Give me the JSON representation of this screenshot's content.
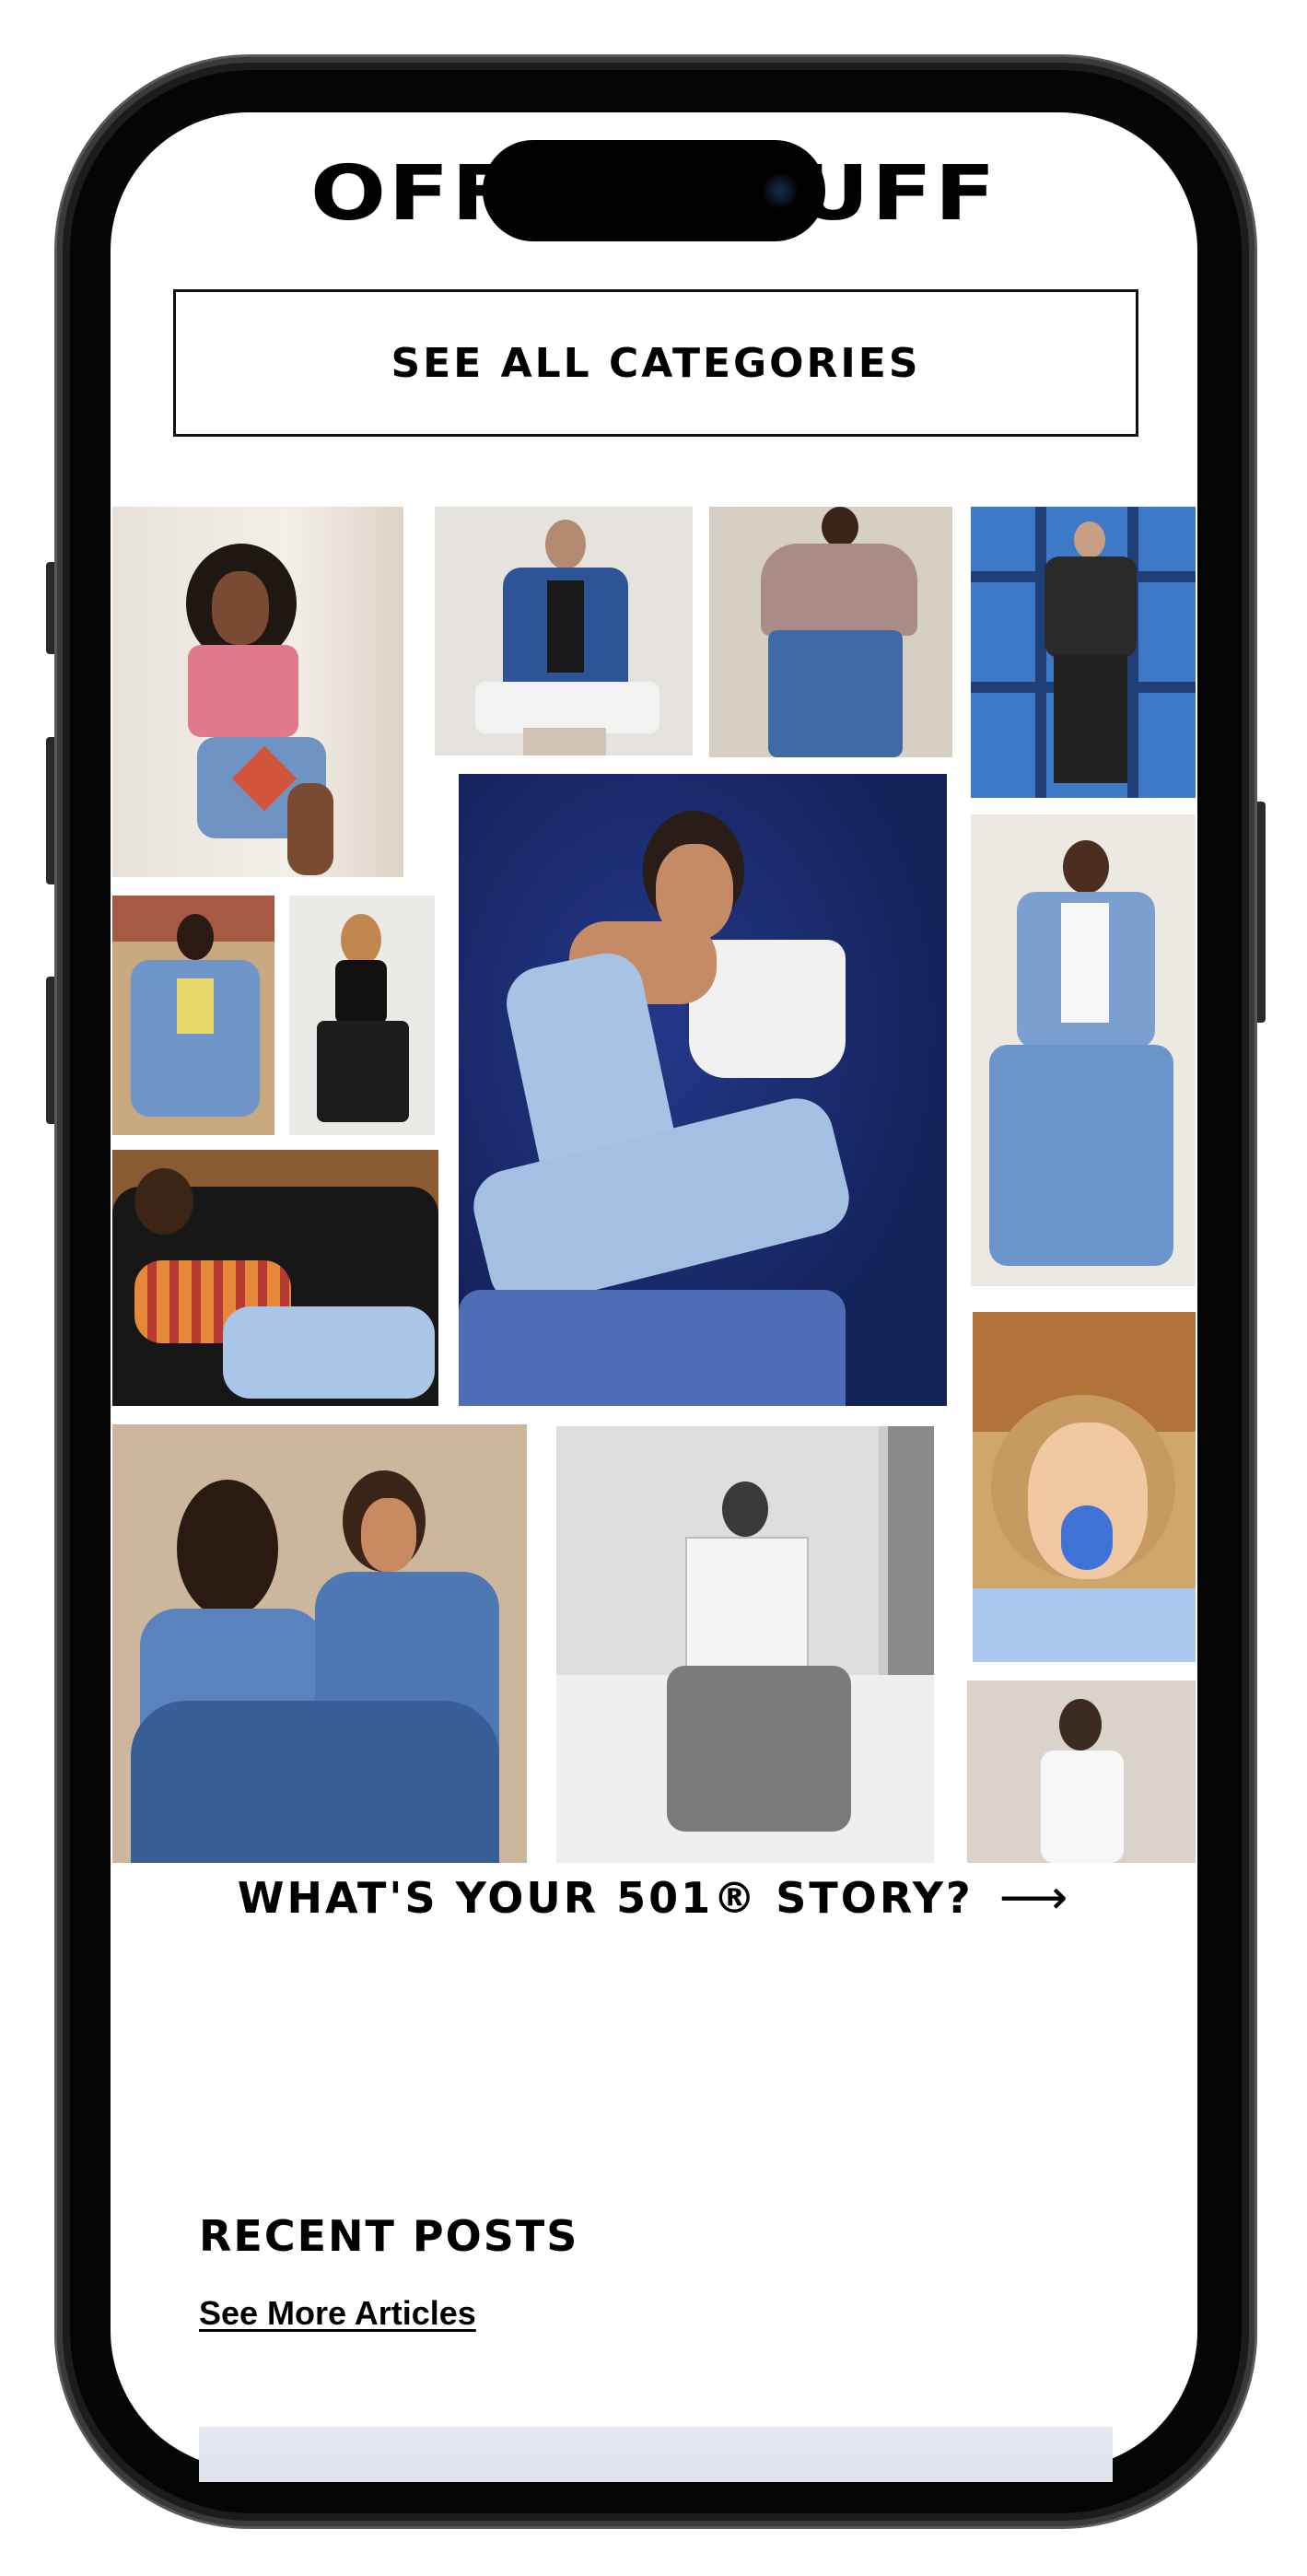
{
  "header": {
    "logo_left": "OFF",
    "logo_right": "UFF"
  },
  "categories_button": "SEE ALL CATEGORIES",
  "collage": {
    "photos": [
      {
        "name": "photo-braids-pink-top"
      },
      {
        "name": "photo-man-denim-jacket"
      },
      {
        "name": "photo-back-mauve-sweater"
      },
      {
        "name": "photo-man-window-shadows"
      },
      {
        "name": "photo-woman-denim-floral"
      },
      {
        "name": "photo-woman-black-outfit"
      },
      {
        "name": "photo-feature-woman-white-top"
      },
      {
        "name": "photo-man-light-denim"
      },
      {
        "name": "photo-woman-couch-striped"
      },
      {
        "name": "photo-woman-blue-tongue"
      },
      {
        "name": "photo-couple-denim-pile"
      },
      {
        "name": "photo-man-black-white"
      },
      {
        "name": "photo-man-white-tee"
      }
    ]
  },
  "story_link": {
    "label": "WHAT'S YOUR 501® STORY?",
    "arrow": "⟶"
  },
  "recent_posts": {
    "heading": "RECENT POSTS",
    "see_more": "See More Articles"
  },
  "colors": {
    "frame": "#1c1c1e",
    "screen": "#ffffff",
    "text": "#000000",
    "denim": "#3f6ea8"
  }
}
